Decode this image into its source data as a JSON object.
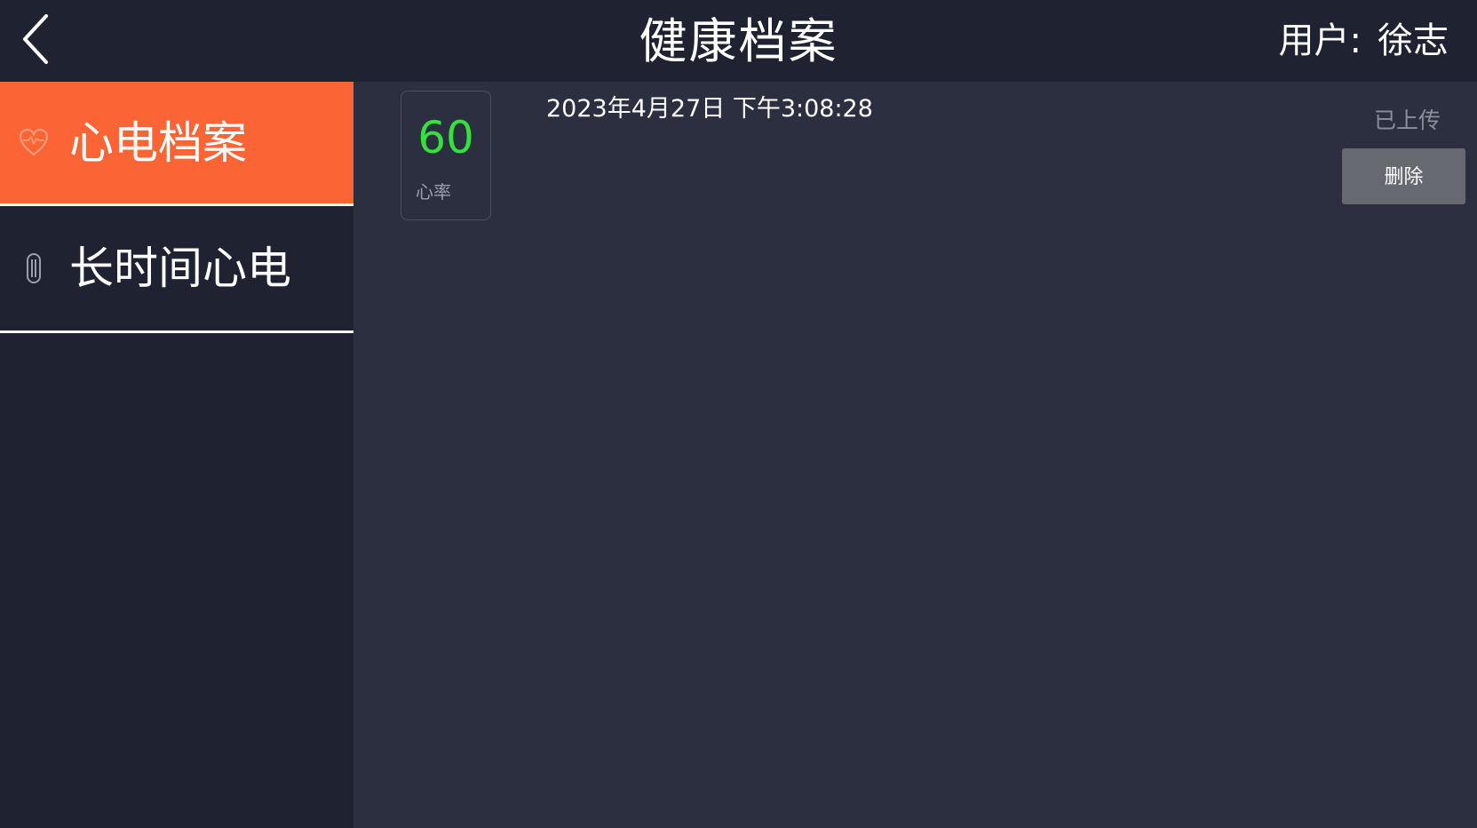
{
  "header": {
    "back_icon": "chevron-left-icon",
    "title": "健康档案",
    "user_label": "用户:",
    "user_name": "徐志"
  },
  "sidebar": {
    "items": [
      {
        "label": "心电档案",
        "icon": "heart-icon",
        "active": true
      },
      {
        "label": "长时间心电",
        "icon": "ecg-patch-icon",
        "active": false
      }
    ]
  },
  "records": [
    {
      "heart_rate": "60",
      "heart_rate_label": "心率",
      "timestamp": "2023年4月27日 下午3:08:28",
      "status": "已上传",
      "delete_label": "删除"
    }
  ],
  "colors": {
    "accent": "#fb6536",
    "heart_rate": "#35e23c",
    "header_bg": "#1f2230",
    "content_bg": "#2b2f40",
    "delete_button_bg": "#666a70"
  }
}
